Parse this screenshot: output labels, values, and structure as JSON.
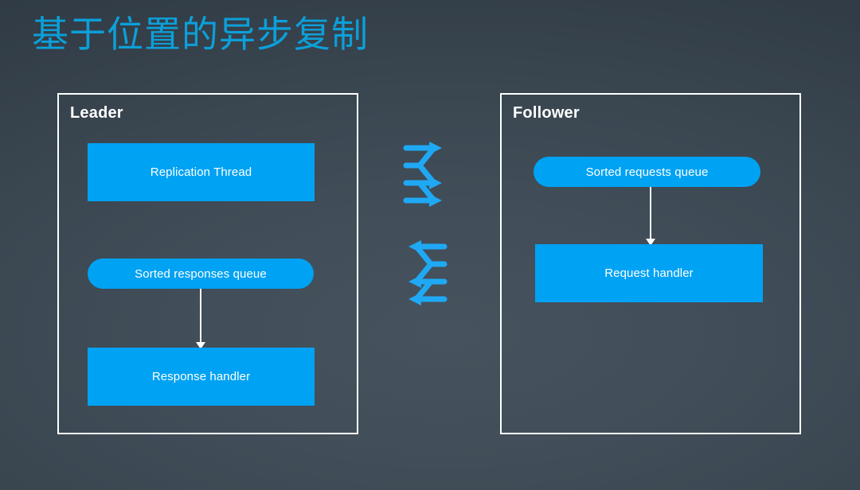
{
  "slide": {
    "title": "基于位置的异步复制",
    "title_color": "#0c9fd9",
    "background_color": "#3a4650",
    "accent_color": "#00a2f3",
    "border_color": "#ffffff"
  },
  "panels": [
    {
      "id": "leader",
      "title": "Leader",
      "nodes": [
        {
          "id": "replication-thread",
          "label": "Replication Thread",
          "shape": "rect"
        },
        {
          "id": "sorted-responses",
          "label": "Sorted responses queue",
          "shape": "pill"
        },
        {
          "id": "response-handler",
          "label": "Response handler",
          "shape": "rect"
        }
      ],
      "arrows": [
        {
          "id": "leader-down",
          "from": "sorted-responses",
          "to": "response-handler",
          "direction": "down"
        }
      ]
    },
    {
      "id": "follower",
      "title": "Follower",
      "nodes": [
        {
          "id": "sorted-requests",
          "label": "Sorted requests queue",
          "shape": "pill"
        },
        {
          "id": "request-handler",
          "label": "Request handler",
          "shape": "rect"
        }
      ],
      "arrows": [
        {
          "id": "follower-down",
          "from": "sorted-requests",
          "to": "request-handler",
          "direction": "down"
        }
      ]
    }
  ],
  "replication_arrows": [
    {
      "id": "to-follower",
      "icon": "serpentine-arrow-right-icon",
      "direction": "right",
      "color": "#1fa9f5"
    },
    {
      "id": "to-leader",
      "icon": "serpentine-arrow-left-icon",
      "direction": "left",
      "color": "#1fa9f5"
    }
  ]
}
